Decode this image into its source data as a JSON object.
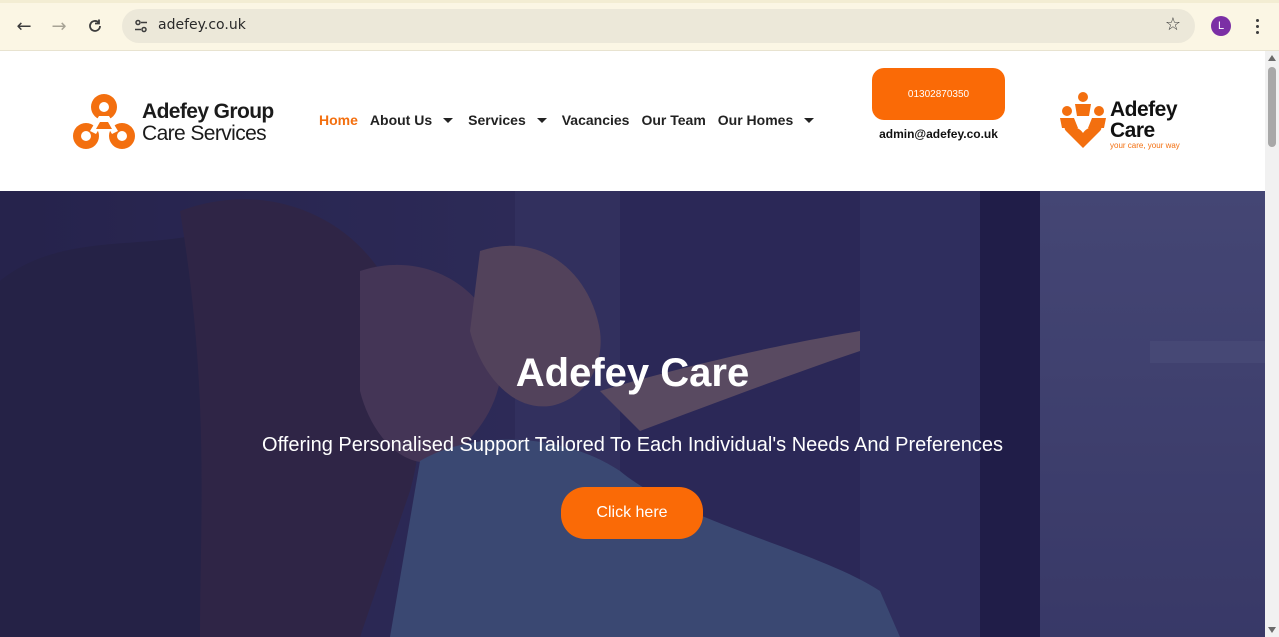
{
  "browser": {
    "url": "adefey.co.uk",
    "profile_initial": "L",
    "icons": {
      "back": "arrow-left-icon",
      "forward": "arrow-right-icon",
      "reload": "reload-icon",
      "site_info": "tune-icon",
      "bookmark": "star-icon",
      "menu": "kebab-menu-icon"
    }
  },
  "header": {
    "brand_left": {
      "line1": "Adefey Group",
      "line2": "Care Services"
    },
    "nav": [
      {
        "label": "Home",
        "active": true,
        "dropdown": false
      },
      {
        "label": "About Us",
        "active": false,
        "dropdown": true
      },
      {
        "label": "Services",
        "active": false,
        "dropdown": true
      },
      {
        "label": "Vacancies",
        "active": false,
        "dropdown": false
      },
      {
        "label": "Our Team",
        "active": false,
        "dropdown": false
      },
      {
        "label": "Our Homes",
        "active": false,
        "dropdown": true
      }
    ],
    "phone": "01302870350",
    "email": "admin@adefey.co.uk",
    "brand_right": {
      "line1": "Adefey",
      "line2": "Care",
      "tagline": "your care, your way"
    }
  },
  "hero": {
    "title": "Adefey Care",
    "subtitle": "Offering Personalised Support Tailored To Each Individual's Needs And Preferences",
    "button": "Click here"
  },
  "colors": {
    "accent": "#fa6a06",
    "nav_active": "#f36f0f",
    "hero_overlay": "#2d2a54"
  }
}
